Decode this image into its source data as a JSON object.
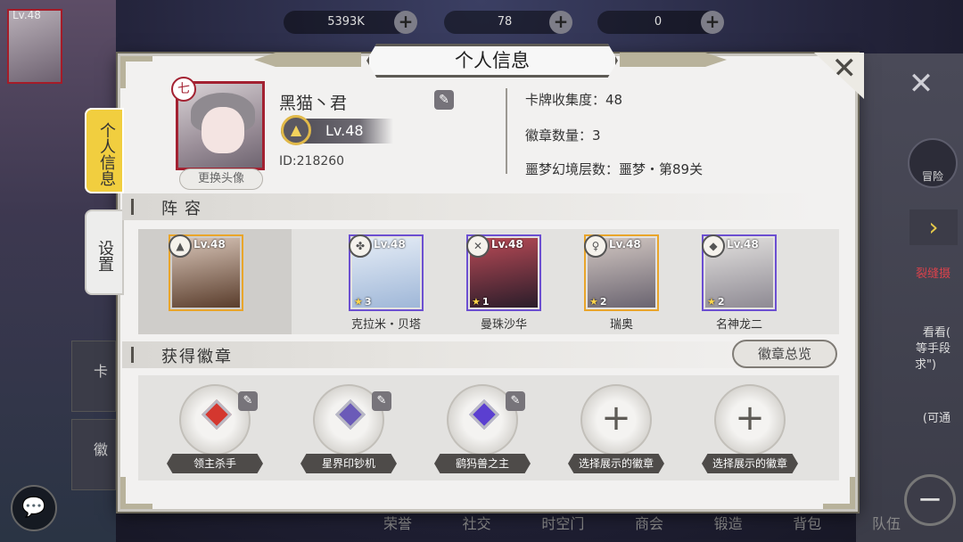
{
  "background": {
    "player_level": "Lv.48",
    "resources": [
      {
        "name": "gold",
        "value": "5393K"
      },
      {
        "name": "gems",
        "value": "78"
      },
      {
        "name": "energy",
        "value": "0"
      }
    ],
    "adventure_label": "冒险",
    "bottom_nav": [
      "荣誉",
      "社交",
      "时空门",
      "商会",
      "锻造",
      "背包",
      "队伍"
    ],
    "left_tabs": [
      "卡",
      "徽"
    ],
    "right_snippets": [
      "裂缝摄",
      "看看(",
      "等手段",
      "求\")",
      "(可通"
    ]
  },
  "dialog": {
    "title": "个人信息",
    "close_icon": "close-icon",
    "side_tabs": [
      {
        "label": "个人信息",
        "active": true
      },
      {
        "label": "设置",
        "active": false
      }
    ]
  },
  "profile": {
    "avatar_badge": "七",
    "change_avatar_label": "更换头像",
    "name": "黑猫丶君",
    "level": "Lv.48",
    "id_text": "ID:218260",
    "stats": [
      "卡牌收集度：48",
      "徽章数量：3",
      "噩梦幻境层数：噩梦・第89关"
    ]
  },
  "lineup": {
    "section_title": "阵容",
    "heroes": [
      {
        "name": "",
        "level": "Lv.48",
        "stars": "",
        "frame": "#e9a52b",
        "art": [
          "#5a3d2c",
          "#d8c5b8"
        ],
        "rank_icon": "▲"
      },
      {
        "name": "克拉米・贝塔",
        "level": "Lv.48",
        "stars": "3",
        "frame": "#6c4fd1",
        "art": [
          "#9fb7d8",
          "#e6edf6"
        ],
        "rank_icon": "✤"
      },
      {
        "name": "曼珠沙华",
        "level": "Lv.48",
        "stars": "1",
        "frame": "#6c4fd1",
        "art": [
          "#2a1d2a",
          "#b94a56"
        ],
        "rank_icon": "✕"
      },
      {
        "name": "瑞奥",
        "level": "Lv.48",
        "stars": "2",
        "frame": "#e9a52b",
        "art": [
          "#6a6470",
          "#d2c7c2"
        ],
        "rank_icon": "♀"
      },
      {
        "name": "名神龙二",
        "level": "Lv.48",
        "stars": "2",
        "frame": "#6c4fd1",
        "art": [
          "#8e8a93",
          "#e2e0de"
        ],
        "rank_icon": "◆"
      }
    ]
  },
  "badges": {
    "section_title": "获得徽章",
    "overview_label": "徽章总览",
    "slots": [
      {
        "label": "领主杀手",
        "filled": true,
        "gem": "#d4372f"
      },
      {
        "label": "星界印钞机",
        "filled": true,
        "gem": "#6b5bb8"
      },
      {
        "label": "鹞犸兽之主",
        "filled": true,
        "gem": "#5b3fd0"
      },
      {
        "label": "选择展示的徽章",
        "filled": false
      },
      {
        "label": "选择展示的徽章",
        "filled": false
      }
    ]
  }
}
